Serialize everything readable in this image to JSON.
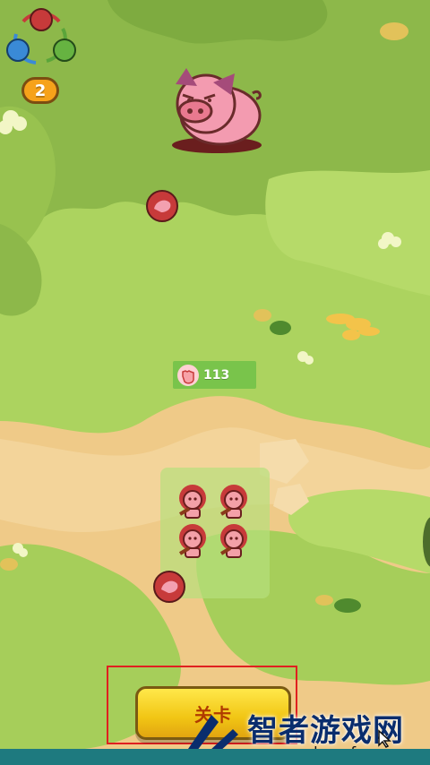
{
  "hud": {
    "level": "2",
    "power_value": "113"
  },
  "button": {
    "start_label": "关卡"
  },
  "watermark": {
    "main": "智者游戏网",
    "sub": "zzslyyxcfy.com"
  },
  "colors": {
    "grass": "#a9cf5a",
    "bush": "#86b34a",
    "dirt": "#f0cc8a",
    "accent_red": "#c73a3a",
    "pig": "#f39bb0"
  },
  "icons": [
    "element-cycle-icon",
    "fist-icon",
    "meat-icon",
    "pig-enemy",
    "lion-warrior-icon",
    "cursor-icon",
    "watermark-logo-icon"
  ]
}
